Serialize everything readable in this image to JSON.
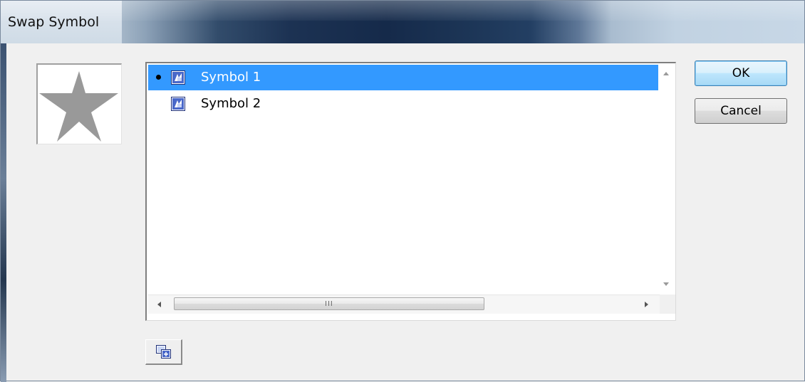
{
  "window": {
    "title": "Swap Symbol"
  },
  "preview": {
    "shape": "star",
    "fill_color": "#999999"
  },
  "symbol_list": {
    "items": [
      {
        "label": "Symbol 1",
        "selected": true,
        "current": true,
        "icon": "movieclip-symbol-icon"
      },
      {
        "label": "Symbol 2",
        "selected": false,
        "current": false,
        "icon": "movieclip-symbol-icon"
      }
    ],
    "selection_color": "#3399ff",
    "horizontal_scrollbar": {
      "grip": "III"
    }
  },
  "buttons": {
    "ok_label": "OK",
    "cancel_label": "Cancel",
    "duplicate_icon": "duplicate-symbol-icon"
  }
}
